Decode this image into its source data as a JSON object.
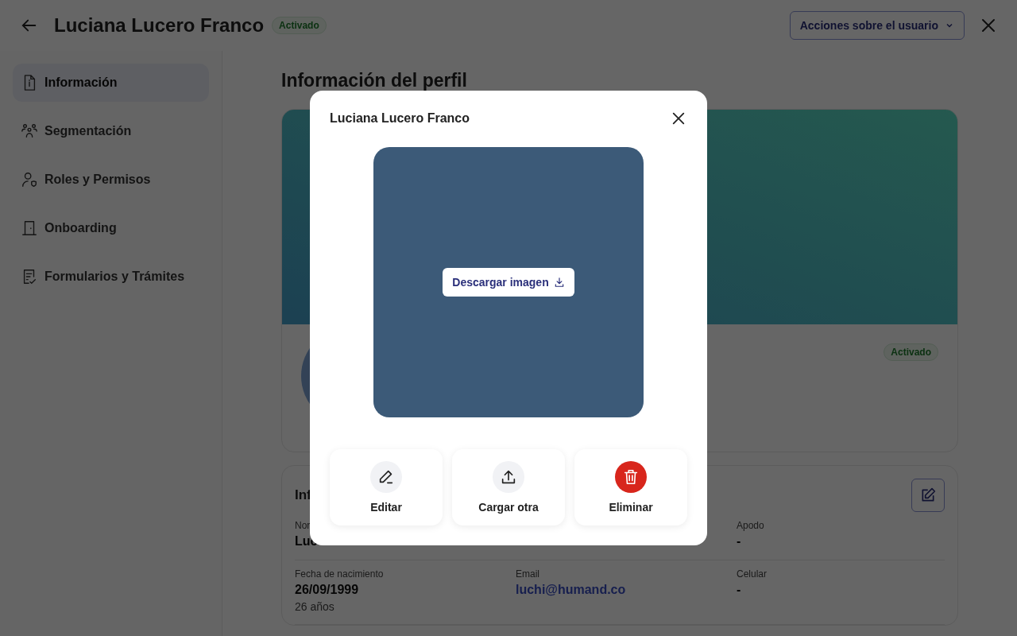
{
  "header": {
    "title": "Luciana Lucero Franco",
    "status": "Activado",
    "actions_button": "Acciones sobre el usuario"
  },
  "sidebar": {
    "items": [
      {
        "label": "Información",
        "selected": true
      },
      {
        "label": "Segmentación",
        "selected": false
      },
      {
        "label": "Roles y Permisos",
        "selected": false
      },
      {
        "label": "Onboarding",
        "selected": false
      },
      {
        "label": "Formularios y Trámites",
        "selected": false
      }
    ]
  },
  "main": {
    "title": "Información del perfil",
    "profile_card": {
      "status": "Activado"
    },
    "info_card": {
      "heading": "Inf",
      "rows": [
        [
          {
            "label": "Nor",
            "value": "Luc"
          },
          "",
          {
            "label": "Apodo",
            "value": "-"
          }
        ],
        [
          {
            "label": "Fecha de nacimiento",
            "value": "26/09/1999",
            "note": "26 años"
          },
          {
            "label": "Email",
            "value": "luchi@humand.co",
            "kind": "link"
          },
          {
            "label": "Celular",
            "value": "-"
          }
        ]
      ]
    }
  },
  "modal": {
    "title": "Luciana Lucero Franco",
    "download_button": "Descargar imagen",
    "actions": [
      {
        "label": "Editar",
        "kind": "default"
      },
      {
        "label": "Cargar otra",
        "kind": "default"
      },
      {
        "label": "Eliminar",
        "kind": "danger"
      }
    ]
  }
}
